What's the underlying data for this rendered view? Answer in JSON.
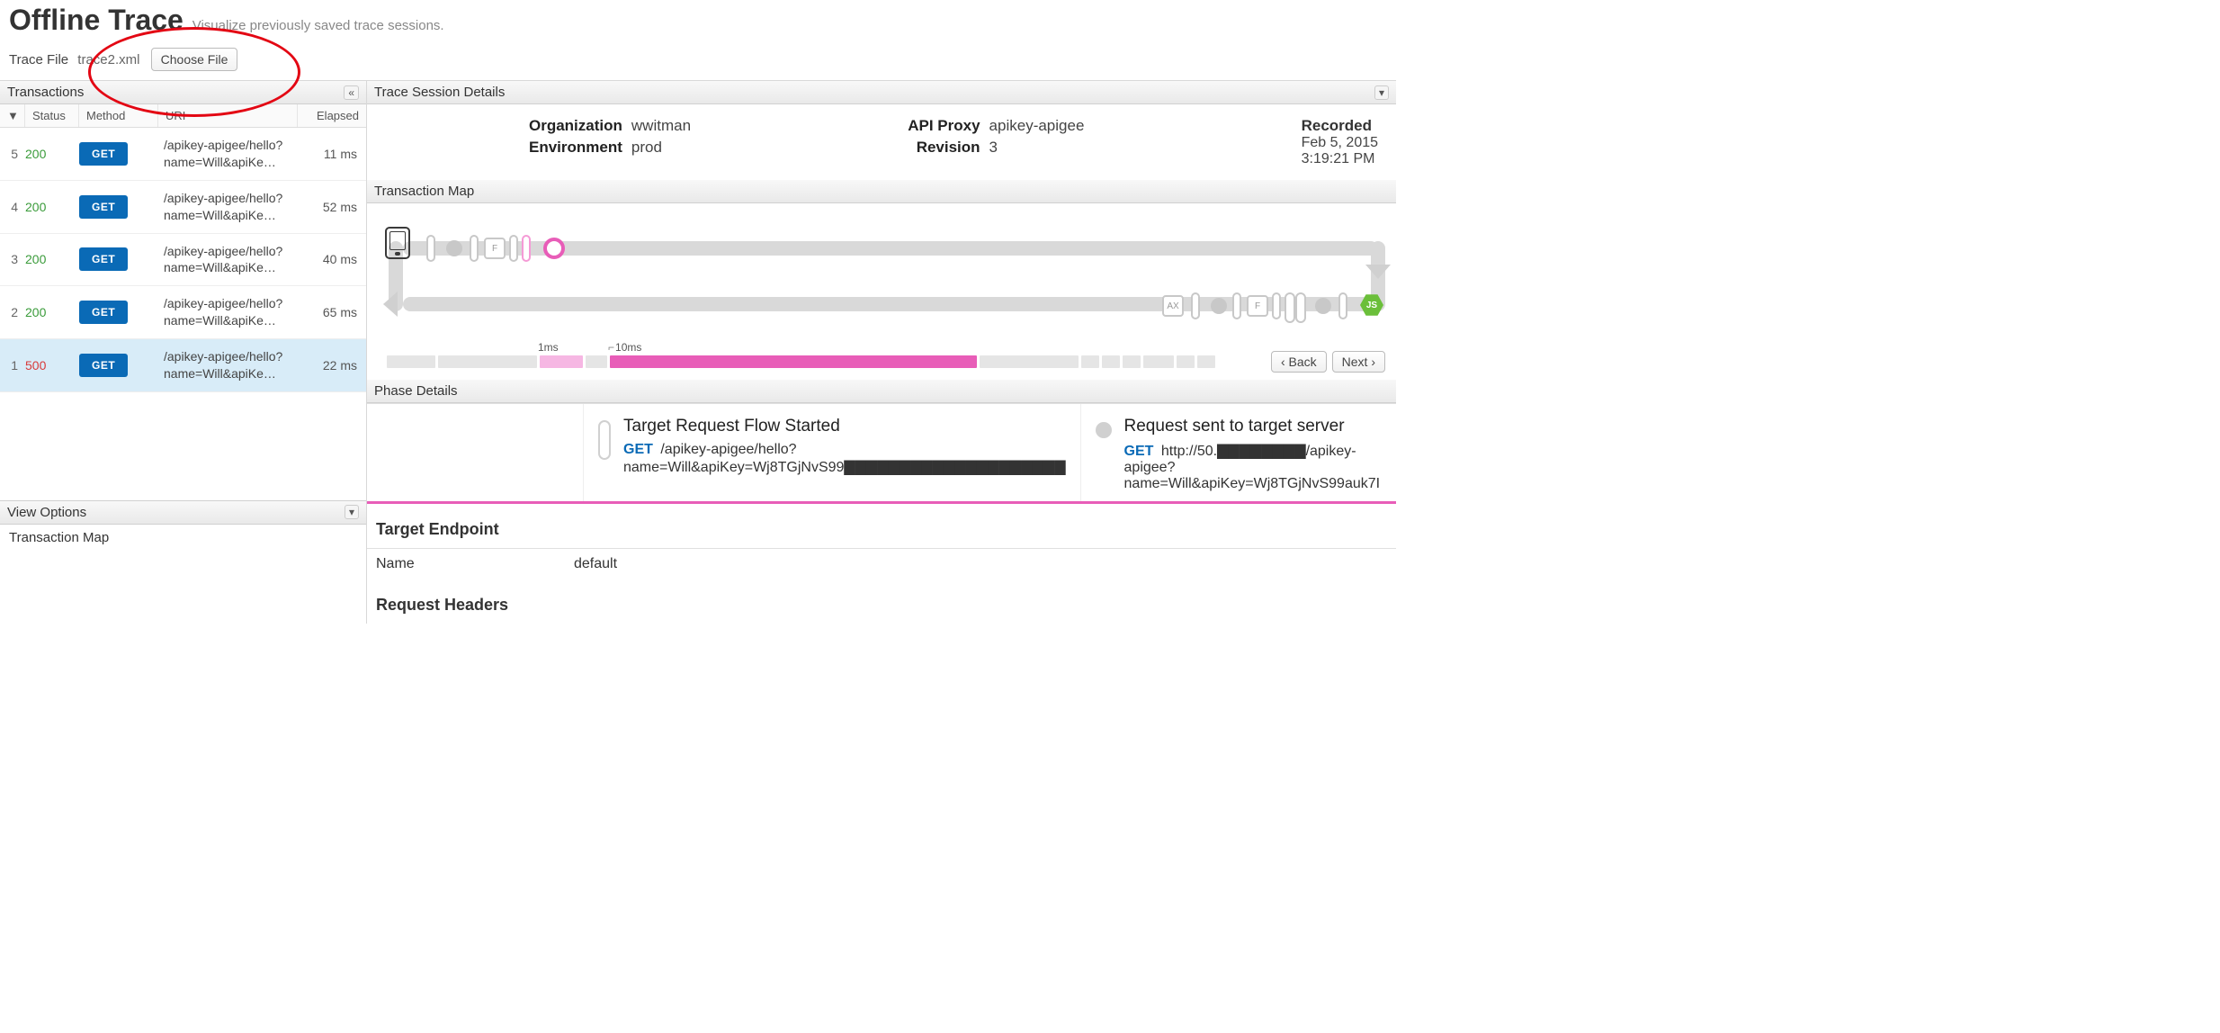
{
  "header": {
    "title": "Offline Trace",
    "subtitle": "Visualize previously saved trace sessions."
  },
  "trace_file": {
    "label": "Trace File",
    "filename": "trace2.xml",
    "choose_label": "Choose File"
  },
  "transactions": {
    "panel_title": "Transactions",
    "collapse_label": "«",
    "columns": {
      "sort": "▼",
      "status": "Status",
      "method": "Method",
      "uri": "URI",
      "elapsed": "Elapsed"
    },
    "rows": [
      {
        "n": "5",
        "status": "200",
        "status_class": "st-200",
        "method": "GET",
        "uri": "/apikey-apigee/hello?name=Will&apiKe…",
        "elapsed": "11 ms",
        "selected": false
      },
      {
        "n": "4",
        "status": "200",
        "status_class": "st-200",
        "method": "GET",
        "uri": "/apikey-apigee/hello?name=Will&apiKe…",
        "elapsed": "52 ms",
        "selected": false
      },
      {
        "n": "3",
        "status": "200",
        "status_class": "st-200",
        "method": "GET",
        "uri": "/apikey-apigee/hello?name=Will&apiKe…",
        "elapsed": "40 ms",
        "selected": false
      },
      {
        "n": "2",
        "status": "200",
        "status_class": "st-200",
        "method": "GET",
        "uri": "/apikey-apigee/hello?name=Will&apiKe…",
        "elapsed": "65 ms",
        "selected": false
      },
      {
        "n": "1",
        "status": "500",
        "status_class": "st-500",
        "method": "GET",
        "uri": "/apikey-apigee/hello?name=Will&apiKe…",
        "elapsed": "22 ms",
        "selected": true
      }
    ]
  },
  "view_options": {
    "panel_title": "View Options",
    "expand_label": "▾",
    "items": [
      "Transaction Map"
    ]
  },
  "session": {
    "panel_title": "Trace Session Details",
    "expand_label": "▾",
    "org_label": "Organization",
    "org": "wwitman",
    "env_label": "Environment",
    "env": "prod",
    "proxy_label": "API Proxy",
    "proxy": "apikey-apigee",
    "rev_label": "Revision",
    "rev": "3",
    "recorded_label": "Recorded",
    "recorded_date": "Feb 5, 2015",
    "recorded_time": "3:19:21 PM"
  },
  "map": {
    "panel_title": "Transaction Map",
    "time_labels": {
      "a": "1ms",
      "b": "10ms"
    },
    "nav": {
      "back": "‹ Back",
      "next": "Next ›"
    }
  },
  "phase": {
    "panel_title": "Phase Details",
    "cells": [
      {
        "title": "Target Request Flow Started",
        "method": "GET",
        "line2": "/apikey-apigee/hello?name=Will&apiKey=Wj8TGjNvS99▇▇▇▇▇▇▇▇▇▇▇▇▇▇▇▇▇▇▇▇"
      },
      {
        "title": "Request sent to target server",
        "method": "GET",
        "line2": "http://50.▇▇▇▇▇▇▇▇/apikey-apigee?name=Will&apiKey=Wj8TGjNvS99auk7I"
      }
    ]
  },
  "target_endpoint": {
    "heading": "Target Endpoint",
    "name_label": "Name",
    "name_value": "default"
  },
  "request_headers": {
    "heading": "Request Headers"
  }
}
